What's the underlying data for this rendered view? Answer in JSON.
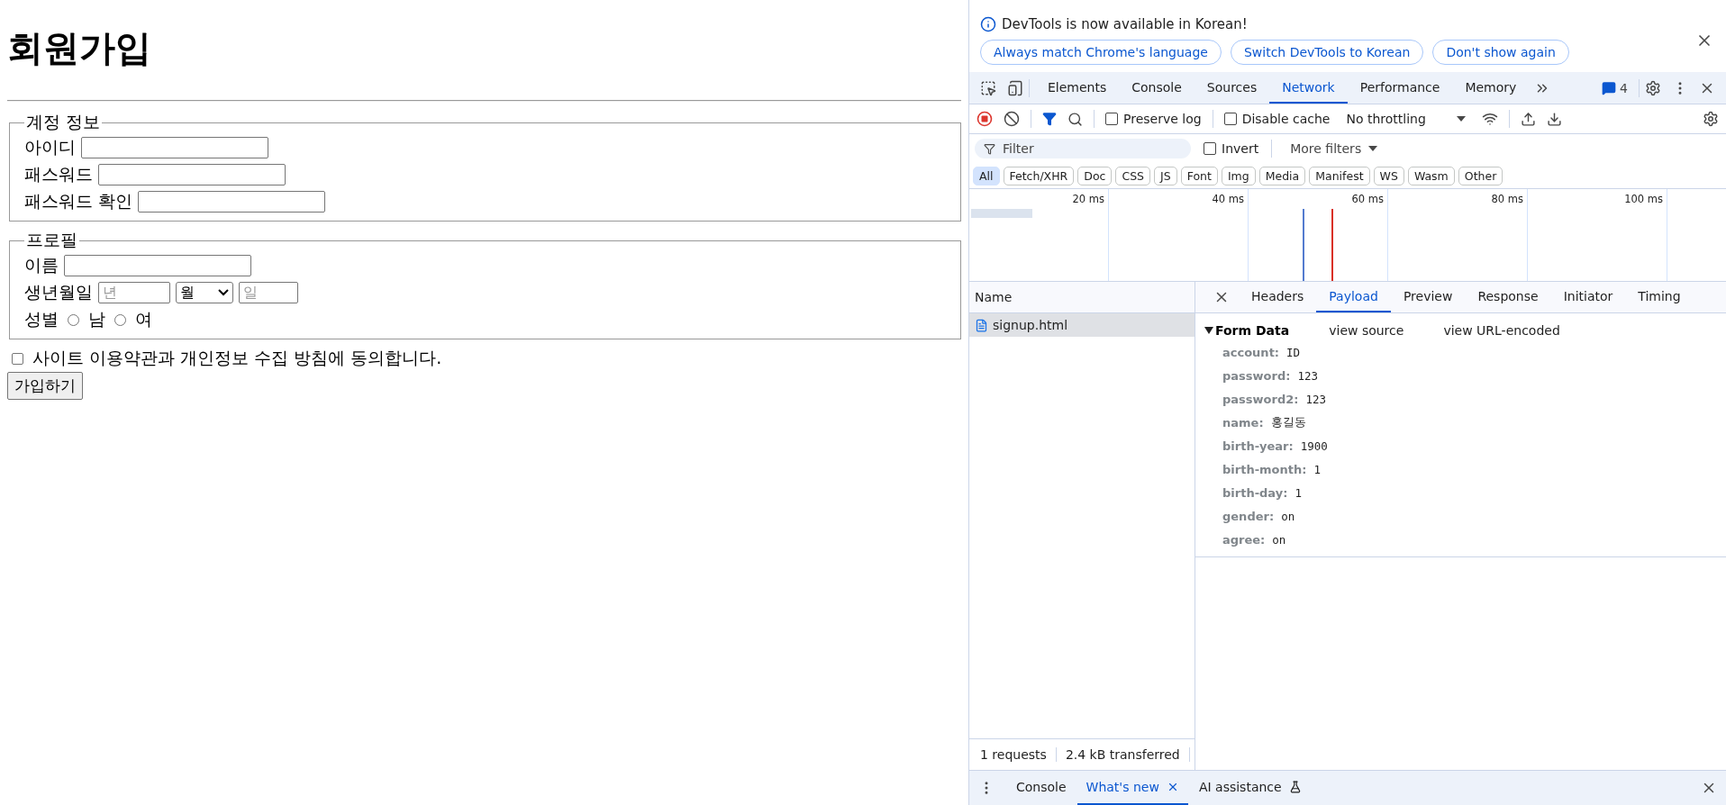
{
  "page": {
    "title": "회원가입",
    "fieldsets": [
      {
        "legend": "계정 정보",
        "rows": [
          {
            "kind": "text",
            "label": "아이디"
          },
          {
            "kind": "text",
            "label": "패스워드"
          },
          {
            "kind": "text",
            "label": "패스워드 확인"
          }
        ]
      },
      {
        "legend": "프로필",
        "rows": [
          {
            "kind": "text",
            "label": "이름"
          },
          {
            "kind": "birth",
            "label": "생년월일",
            "year_placeholder": "년",
            "month_value": "월",
            "day_placeholder": "일"
          },
          {
            "kind": "radio",
            "label": "성별",
            "options": [
              {
                "label": "남",
                "selected": false
              },
              {
                "label": "여",
                "selected": false
              }
            ]
          }
        ]
      }
    ],
    "agree": {
      "label": "사이트 이용약관과 개인정보 수집 방침에 동의합니다.",
      "checked": false
    },
    "submit": "가입하기"
  },
  "devtools": {
    "infobar": {
      "message": "DevTools is now available in Korean!",
      "buttons": [
        "Always match Chrome's language",
        "Switch DevTools to Korean",
        "Don't show again"
      ]
    },
    "tabs": [
      {
        "label": "Elements",
        "selected": false
      },
      {
        "label": "Console",
        "selected": false
      },
      {
        "label": "Sources",
        "selected": false
      },
      {
        "label": "Network",
        "selected": true
      },
      {
        "label": "Performance",
        "selected": false
      },
      {
        "label": "Memory",
        "selected": false
      }
    ],
    "issues_count": "4",
    "toolbar": {
      "preserve_log": {
        "label": "Preserve log",
        "checked": false
      },
      "disable_cache": {
        "label": "Disable cache",
        "checked": false
      },
      "throttling": "No throttling"
    },
    "filter": {
      "placeholder": "Filter",
      "invert": {
        "label": "Invert",
        "checked": false
      },
      "more_filters": "More filters"
    },
    "type_filters": [
      {
        "label": "All",
        "selected": true
      },
      {
        "label": "Fetch/XHR",
        "selected": false
      },
      {
        "label": "Doc",
        "selected": false
      },
      {
        "label": "CSS",
        "selected": false
      },
      {
        "label": "JS",
        "selected": false
      },
      {
        "label": "Font",
        "selected": false
      },
      {
        "label": "Img",
        "selected": false
      },
      {
        "label": "Media",
        "selected": false
      },
      {
        "label": "Manifest",
        "selected": false
      },
      {
        "label": "WS",
        "selected": false
      },
      {
        "label": "Wasm",
        "selected": false
      },
      {
        "label": "Other",
        "selected": false
      }
    ],
    "timeline_ticks": [
      "20 ms",
      "40 ms",
      "60 ms",
      "80 ms",
      "100 ms"
    ],
    "requests": {
      "column": "Name",
      "items": [
        {
          "name": "signup.html",
          "selected": true
        }
      ]
    },
    "detail_tabs": [
      {
        "label": "Headers",
        "selected": false
      },
      {
        "label": "Payload",
        "selected": true
      },
      {
        "label": "Preview",
        "selected": false
      },
      {
        "label": "Response",
        "selected": false
      },
      {
        "label": "Initiator",
        "selected": false
      },
      {
        "label": "Timing",
        "selected": false
      }
    ],
    "payload": {
      "section": "Form Data",
      "expanded": true,
      "links": [
        "view source",
        "view URL-encoded"
      ],
      "fields": [
        {
          "key": "account:",
          "value": "ID"
        },
        {
          "key": "password:",
          "value": "123"
        },
        {
          "key": "password2:",
          "value": "123"
        },
        {
          "key": "name:",
          "value": "홍길동"
        },
        {
          "key": "birth-year:",
          "value": "1900"
        },
        {
          "key": "birth-month:",
          "value": "1"
        },
        {
          "key": "birth-day:",
          "value": "1"
        },
        {
          "key": "gender:",
          "value": "on"
        },
        {
          "key": "agree:",
          "value": "on"
        }
      ]
    },
    "status": [
      "1 requests",
      "2.4 kB transferred"
    ],
    "drawer_tabs": [
      {
        "kind": "plain",
        "label": "Console",
        "selected": false
      },
      {
        "kind": "closable",
        "label": "What's new",
        "selected": true
      },
      {
        "kind": "experimental",
        "label": "AI assistance",
        "selected": false
      }
    ]
  }
}
